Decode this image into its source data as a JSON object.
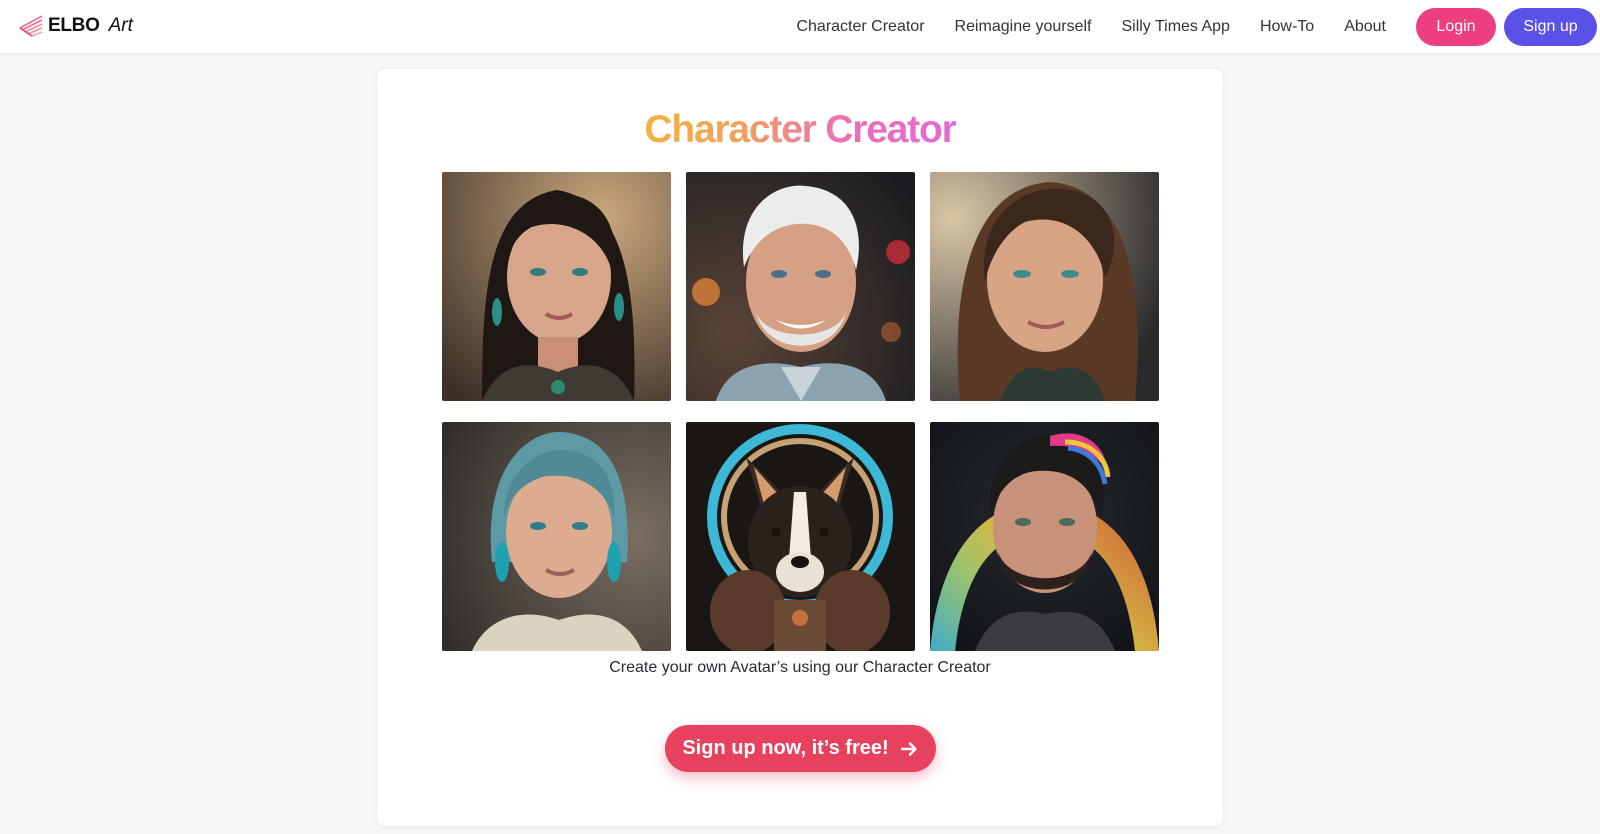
{
  "header": {
    "logo_text": "ELBO",
    "logo_sub": "Art",
    "nav": [
      {
        "label": "Character Creator"
      },
      {
        "label": "Reimagine yourself"
      },
      {
        "label": "Silly Times App"
      },
      {
        "label": "How-To"
      },
      {
        "label": "About"
      }
    ],
    "login_label": "Login",
    "signup_label": "Sign up"
  },
  "main": {
    "title": "Character Creator",
    "caption": "Create your own Avatar’s using our Character Creator",
    "cta_label": "Sign up now, it’s free!",
    "gallery": [
      {
        "icon": "woman-dark-hair-portrait"
      },
      {
        "icon": "white-haired-man-portrait"
      },
      {
        "icon": "woman-brown-hair-portrait"
      },
      {
        "icon": "woman-teal-hair-portrait"
      },
      {
        "icon": "dog-portrait"
      },
      {
        "icon": "man-rainbow-hair-portrait"
      }
    ]
  },
  "colors": {
    "login": "#ee3e82",
    "signup": "#5a52e6",
    "cta": "#e8415e",
    "title_gradient": [
      "#f6b23f",
      "#e06ad8"
    ]
  }
}
